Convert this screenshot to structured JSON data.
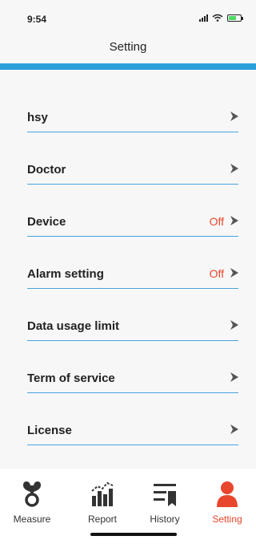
{
  "status": {
    "time": "9:54"
  },
  "header": {
    "title": "Setting"
  },
  "settings": {
    "items": [
      {
        "label": "hsy",
        "value": ""
      },
      {
        "label": "Doctor",
        "value": ""
      },
      {
        "label": "Device",
        "value": "Off"
      },
      {
        "label": "Alarm setting",
        "value": "Off"
      },
      {
        "label": "Data usage limit",
        "value": ""
      },
      {
        "label": "Term of service",
        "value": ""
      },
      {
        "label": "License",
        "value": ""
      }
    ]
  },
  "tabs": [
    {
      "label": "Measure",
      "icon": "measure-icon"
    },
    {
      "label": "Report",
      "icon": "report-icon"
    },
    {
      "label": "History",
      "icon": "history-icon"
    },
    {
      "label": "Setting",
      "icon": "user-icon",
      "active": true
    }
  ],
  "colors": {
    "accent": "#2a9fd9",
    "active": "#e8472e",
    "icon": "#333333",
    "divider": "#4aa3df"
  }
}
